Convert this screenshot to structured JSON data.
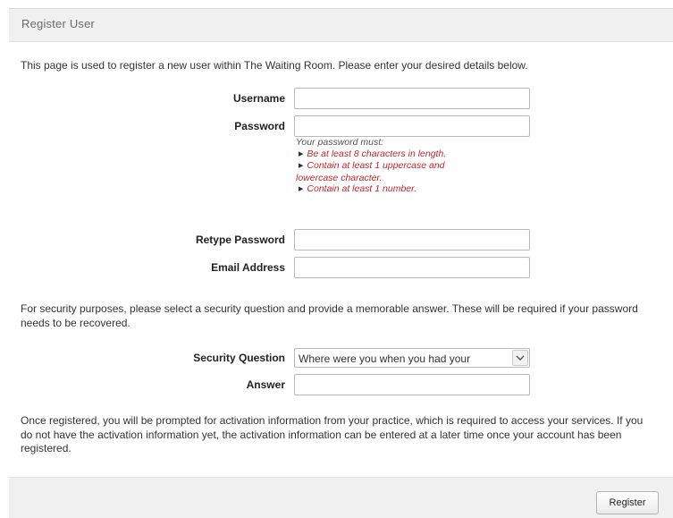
{
  "panel": {
    "title": "Register User"
  },
  "intro_text": "This page is used to register a new user within The Waiting Room. Please enter your desired details below.",
  "fields": {
    "username": {
      "label": "Username",
      "value": ""
    },
    "password": {
      "label": "Password",
      "value": ""
    },
    "retype_password": {
      "label": "Retype Password",
      "value": ""
    },
    "email": {
      "label": "Email Address",
      "value": ""
    },
    "security_question": {
      "label": "Security Question",
      "selected": "Where were you when you had your"
    },
    "answer": {
      "label": "Answer",
      "value": ""
    }
  },
  "password_rules": {
    "intro": "Your password must:",
    "rule1": "Be at least 8 characters in length.",
    "rule2_line1": "Contain at least 1 uppercase and",
    "rule2_line2": "lowercase character.",
    "rule3": "Contain at least 1 number.",
    "colors": {
      "rule": "#c0272d",
      "bullet": "#1d2a57"
    }
  },
  "security_text": "For security purposes, please select a security question and provide a memorable answer. These will be required if your password needs to be recovered.",
  "activation_text": "Once registered, you will be prompted for activation information from your practice, which is required to access your services. If you do not have the activation information yet, the activation information can be entered at a later time once your account has been registered.",
  "actions": {
    "register_label": "Register"
  },
  "icons": {
    "rule_bullet": "triangle-right-icon",
    "select_arrow": "chevron-down-icon"
  }
}
